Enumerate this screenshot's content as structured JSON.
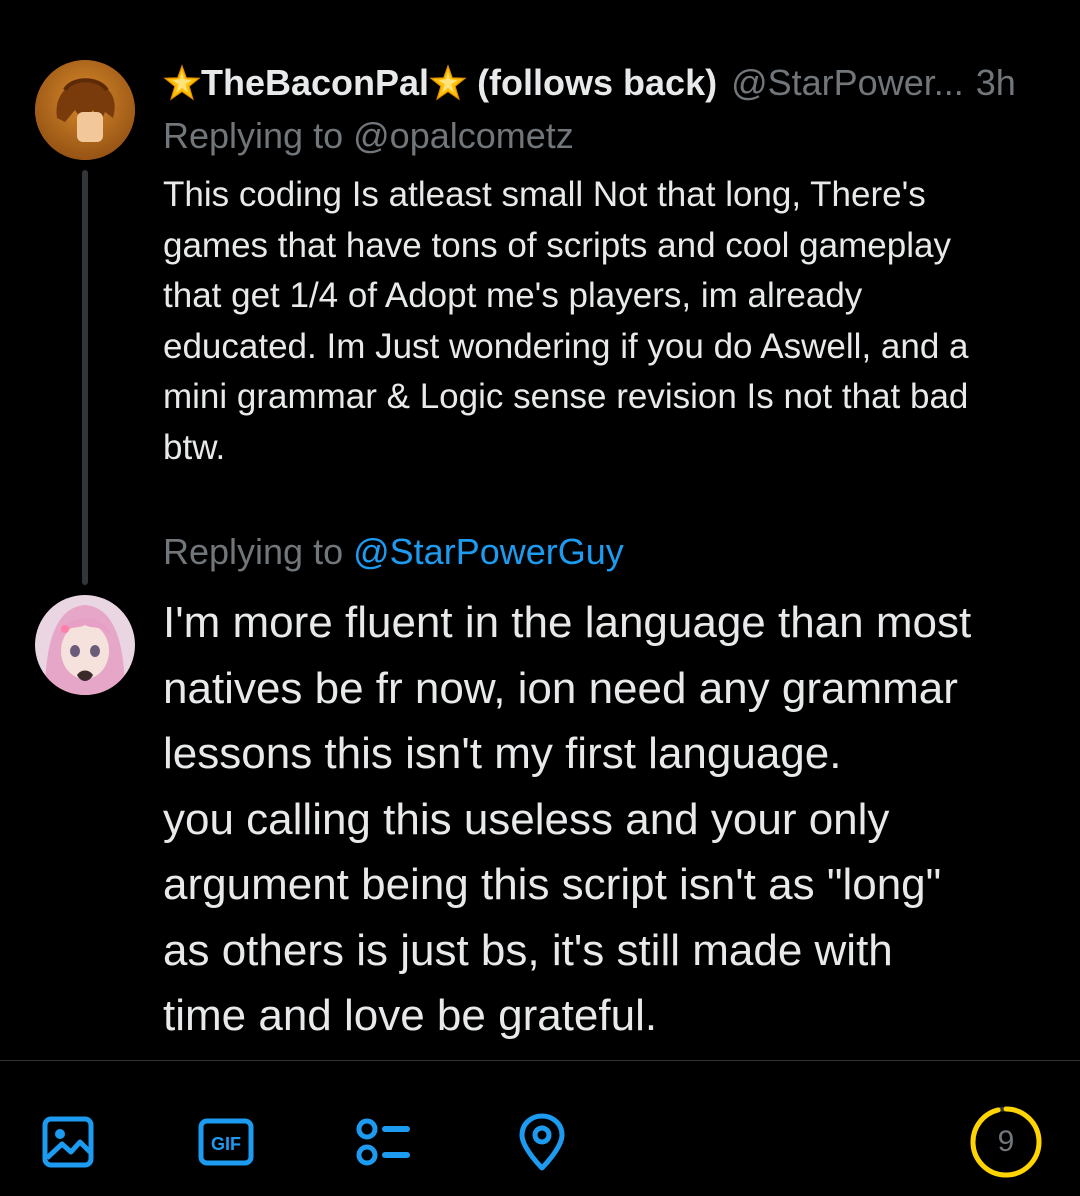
{
  "original_tweet": {
    "display_name": "TheBaconPal",
    "display_name_emoji": "glowing-star-icon",
    "follows_back_label": "(follows back)",
    "handle": "@StarPower...",
    "time": "3h",
    "replying_prefix": "Replying to",
    "replying_to": "@opalcometz",
    "text": "This coding Is atleast small Not that long, There's\ngames that have tons of scripts and cool gameplay\nthat get 1/4 of Adopt me's players, im already\neducated. Im Just wondering if you do Aswell, and a\nmini grammar & Logic sense revision Is not that bad\nbtw."
  },
  "reply_draft": {
    "replying_prefix": "Replying to",
    "replying_to": "@StarPowerGuy",
    "text": "I'm more fluent in the language than most\nnatives be fr now, ion need any grammar\nlessons this isn't my first language.\nyou calling this useless and your only\nargument being this script isn't as \"long\"\nas others is just bs, it's still made with\ntime and love be grateful."
  },
  "toolbar": {
    "icons": [
      "image-icon",
      "gif-icon",
      "poll-icon",
      "location-icon"
    ],
    "gif_label": "GIF",
    "char_counter": "9",
    "char_counter_fraction_used": 0.96
  },
  "colors": {
    "background": "#000000",
    "text": "#e7e9ea",
    "muted": "#71767b",
    "accent": "#1d9bf0",
    "counter_warning": "#ffd400"
  }
}
